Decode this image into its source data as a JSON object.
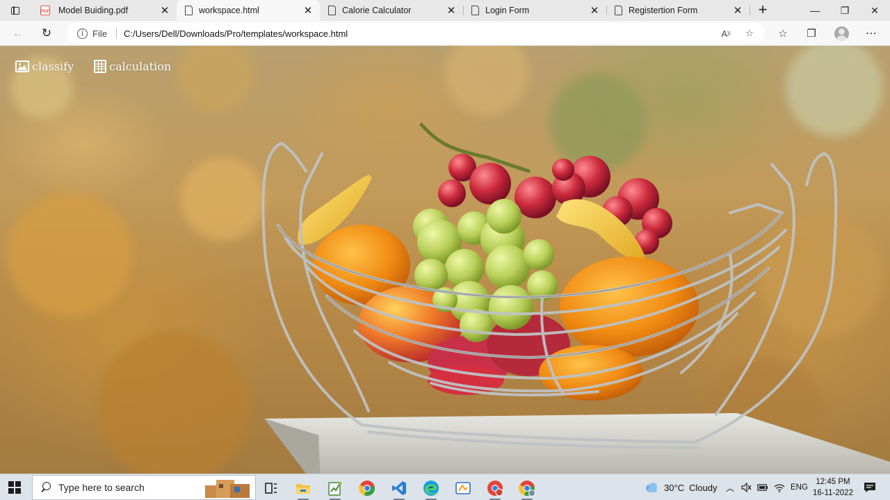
{
  "browser": {
    "tabs": [
      {
        "title": "Model Buiding.pdf",
        "icon": "pdf-icon",
        "active": false
      },
      {
        "title": "workspace.html",
        "icon": "document-icon",
        "active": true
      },
      {
        "title": "Calorie Calculator",
        "icon": "document-icon",
        "active": false
      },
      {
        "title": "Login Form",
        "icon": "document-icon",
        "active": false
      },
      {
        "title": "Registertion Form",
        "icon": "document-icon",
        "active": false
      }
    ],
    "tab_close_glyph": "✕",
    "new_tab_glyph": "+",
    "window_controls": {
      "minimize": "—",
      "maximize": "❐",
      "close": "✕"
    },
    "address": {
      "scheme_label": "File",
      "url": "C:/Users/Dell/Downloads/Pro/templates/workspace.html"
    }
  },
  "page": {
    "nav": [
      {
        "label": "classify",
        "icon": "image-icon"
      },
      {
        "label": "calculation",
        "icon": "calculator-icon"
      }
    ],
    "hero_image": "fruit-basket-photo"
  },
  "taskbar": {
    "search_placeholder": "Type here to search",
    "apps": [
      "task-view",
      "file-explorer",
      "text-editor",
      "chrome",
      "vscode",
      "edge",
      "snipping-tool",
      "chrome-profile-1",
      "chrome-profile-2"
    ],
    "weather": {
      "temp": "30°C",
      "condition": "Cloudy"
    },
    "language": "ENG",
    "time": "12:45 PM",
    "date": "16-11-2022"
  },
  "colors": {
    "tabstrip": "#e8e8e8",
    "active_tab": "#f7f7f7",
    "taskbar": "#dde3ea",
    "vscode_blue": "#2a7bd4",
    "edge_teal": "#1b9de2",
    "chrome_red": "#e2443a"
  }
}
